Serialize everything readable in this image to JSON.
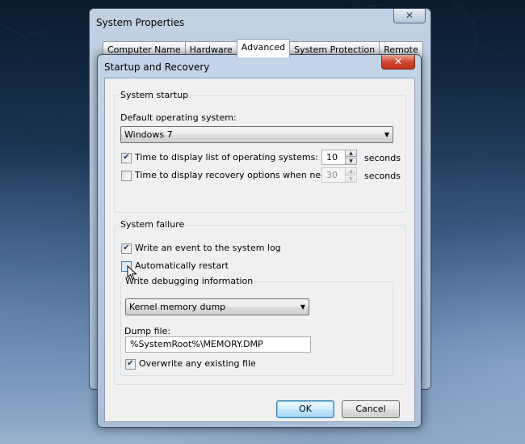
{
  "outer_window": {
    "title": "System Properties",
    "close_glyph": "✕",
    "tabs": [
      {
        "label": "Computer Name",
        "active": false
      },
      {
        "label": "Hardware",
        "active": false
      },
      {
        "label": "Advanced",
        "active": true
      },
      {
        "label": "System Protection",
        "active": false
      },
      {
        "label": "Remote",
        "active": false
      }
    ]
  },
  "dialog": {
    "title": "Startup and Recovery",
    "close_glyph": "✕",
    "system_startup": {
      "legend": "System startup",
      "default_os_label": "Default operating system:",
      "default_os_value": "Windows 7",
      "display_list": {
        "label": "Time to display list of operating systems:",
        "checked": true,
        "value": "10",
        "unit": "seconds"
      },
      "display_recovery": {
        "label": "Time to display recovery options when needed:",
        "checked": false,
        "value": "30",
        "unit": "seconds"
      }
    },
    "system_failure": {
      "legend": "System failure",
      "write_event": {
        "label": "Write an event to the system log",
        "checked": true
      },
      "auto_restart": {
        "label": "Automatically restart",
        "checked": false
      },
      "debug": {
        "legend": "Write debugging information",
        "dump_type": "Kernel memory dump",
        "dump_file_label": "Dump file:",
        "dump_file_value": "%SystemRoot%\\MEMORY.DMP",
        "overwrite": {
          "label": "Overwrite any existing file",
          "checked": true
        }
      }
    },
    "buttons": {
      "ok": "OK",
      "cancel": "Cancel"
    }
  },
  "icons": {
    "checked_glyph": "✔",
    "dropdown_glyph": "▼",
    "spin_up_glyph": "▲",
    "spin_down_glyph": "▼"
  }
}
